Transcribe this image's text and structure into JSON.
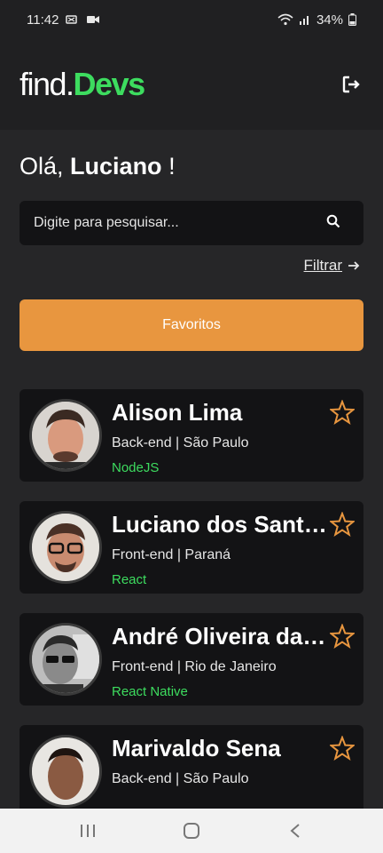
{
  "status_bar": {
    "time": "11:42",
    "battery": "34%"
  },
  "header": {
    "logo_part1": "find.",
    "logo_part2": "Devs"
  },
  "greeting": {
    "prefix": "Olá,",
    "name": "Luciano",
    "suffix": "!"
  },
  "search": {
    "placeholder": "Digite para pesquisar..."
  },
  "filter": {
    "label": "Filtrar"
  },
  "favorites_button": {
    "label": "Favoritos"
  },
  "devs": [
    {
      "name": "Alison Lima",
      "role": "Back-end | São Paulo",
      "tech": "NodeJS"
    },
    {
      "name": "Luciano dos Santos",
      "role": "Front-end | Paraná",
      "tech": "React"
    },
    {
      "name": "André Oliveira da Silva",
      "role": "Front-end | Rio de Janeiro",
      "tech": "React Native"
    },
    {
      "name": "Marivaldo Sena",
      "role": "Back-end | São Paulo",
      "tech": ""
    }
  ],
  "colors": {
    "accent": "#3ddc5f",
    "button": "#e8963f",
    "star": "#e8963f",
    "background": "#262628",
    "card": "#131315"
  },
  "icons": [
    "search-icon",
    "logout-icon",
    "arrow-right-icon",
    "star-outline-icon",
    "menu-icon",
    "home-icon",
    "back-icon"
  ]
}
